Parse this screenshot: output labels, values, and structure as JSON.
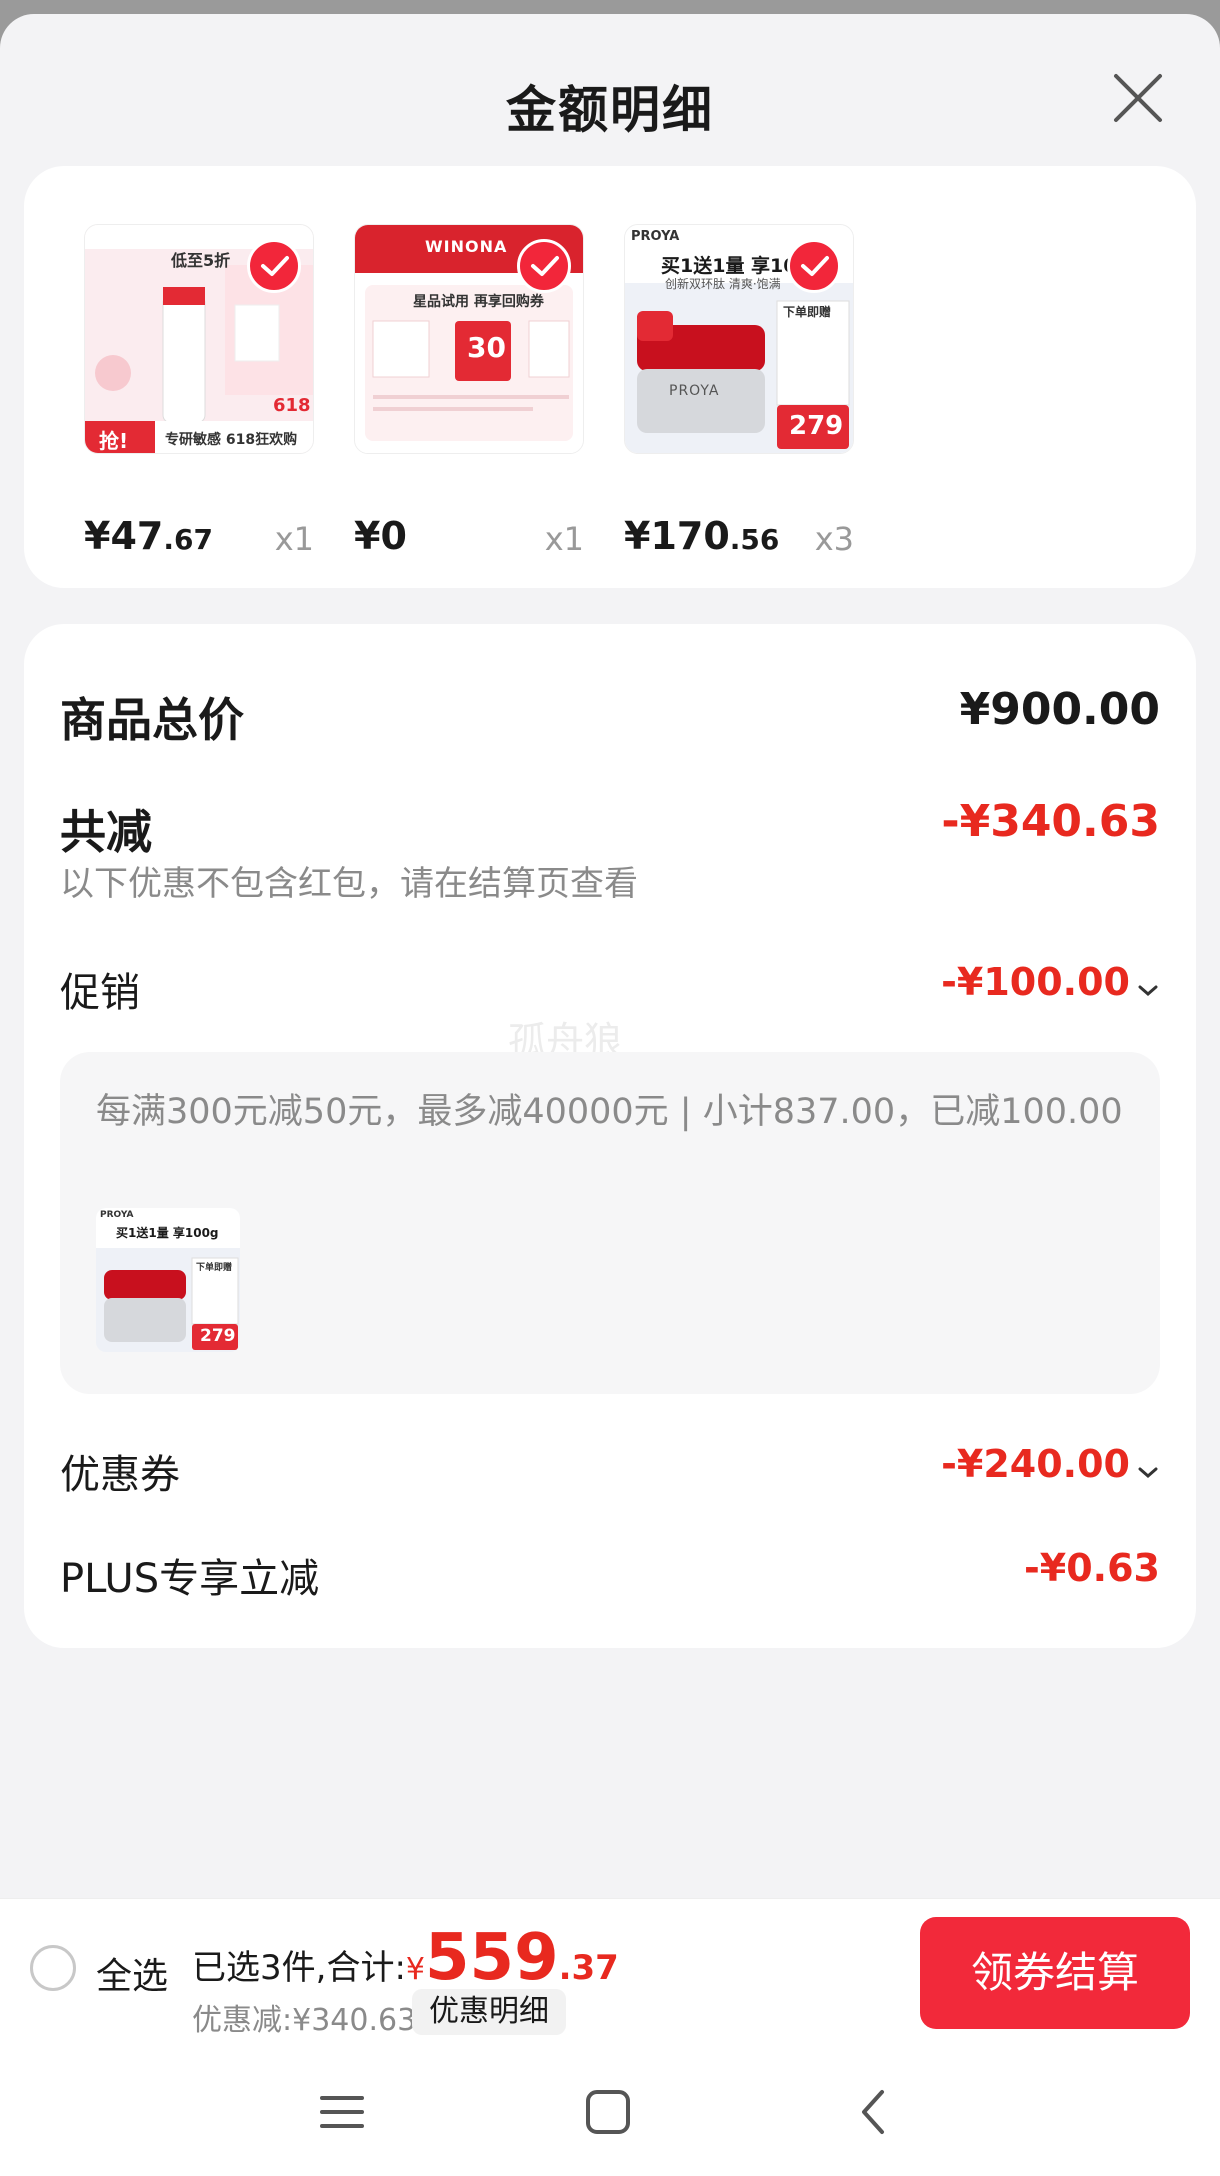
{
  "header": {
    "title": "金额明细",
    "close_icon": "close-icon"
  },
  "products": [
    {
      "price_int": "¥47",
      "price_dec": ".67",
      "qty": "x1",
      "icon": "product-thumbnail-cleanser",
      "thumb_text": {
        "promo": "低至5折",
        "tag": "抢!",
        "footer": "专研敏感 618狂欢购",
        "badge": "618"
      }
    },
    {
      "price_int": "¥0",
      "price_dec": "",
      "qty": "x1",
      "icon": "product-thumbnail-trial",
      "thumb_text": {
        "brand": "WINONA",
        "promo": "星品试用 再享回购券",
        "coupon": "30"
      }
    },
    {
      "price_int": "¥170",
      "price_dec": ".56",
      "qty": "x3",
      "icon": "product-thumbnail-cream",
      "thumb_text": {
        "brand": "PROYA",
        "promo": "买1送1量 享10",
        "sub": "创新双环肽 清爽·饱满",
        "price": "279",
        "gift": "下单即赠"
      }
    }
  ],
  "summary": {
    "total_label": "商品总价",
    "total_value": "¥900.00",
    "reduce_label": "共减",
    "reduce_value": "-¥340.63",
    "note": "以下优惠不包含红包，请在结算页查看",
    "promo_label": "促销",
    "promo_value": "-¥100.00",
    "promo_detail": "每满300元减50元，最多减40000元 | 小计837.00，已减100.00",
    "promo_thumb": {
      "brand": "PROYA",
      "promo": "买1送1量 享100g",
      "price": "279",
      "gift": "下单即赠"
    },
    "coupon_label": "优惠券",
    "coupon_value": "-¥240.00",
    "plus_label": "PLUS专享立减",
    "plus_value": "-¥0.63"
  },
  "watermark": "孤舟狼",
  "bottom_bar": {
    "select_all": "全选",
    "selected_text": "已选3件,合计:",
    "currency": "¥",
    "total_int": "559",
    "total_dec": ".37",
    "discount_text": "优惠减:¥340.63",
    "detail_button": "优惠明细",
    "checkout_button": "领券结算"
  },
  "navbar": {
    "icons": [
      "menu-icon",
      "home-square-icon",
      "back-chevron-icon"
    ]
  },
  "colors": {
    "accent_red": "#e8291f",
    "button_red": "#f2293a",
    "background": "#f3f3f5"
  }
}
